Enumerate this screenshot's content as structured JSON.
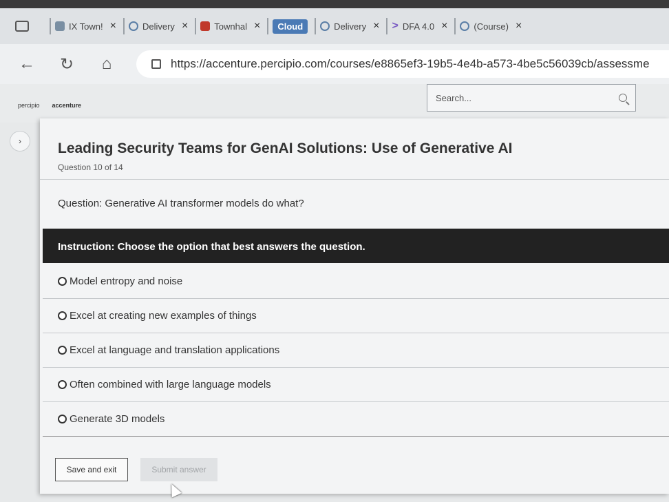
{
  "browser": {
    "tabs": [
      {
        "label": "IX Town!",
        "icon": "people-icon"
      },
      {
        "label": "Delivery",
        "icon": "w-logo-icon"
      },
      {
        "label": "Townhal",
        "icon": "red-icon"
      },
      {
        "label": "Cloud",
        "icon": "cloud-chip"
      },
      {
        "label": "Delivery",
        "icon": "w-logo-icon"
      },
      {
        "label": "DFA 4.0",
        "icon": "arrow-icon"
      },
      {
        "label": "(Course)",
        "icon": "w-logo-icon"
      }
    ],
    "url": "https://accenture.percipio.com/courses/e8865ef3-19b5-4e4b-a573-4be5c56039cb/assessme"
  },
  "header": {
    "logo_left": "percipio",
    "logo_right": "accenture",
    "search_placeholder": "Search..."
  },
  "quiz": {
    "title": "Leading Security Teams for GenAI Solutions: Use of Generative AI",
    "question_number": "Question 10 of 14",
    "question": "Question: Generative AI transformer models do what?",
    "instruction": "Instruction: Choose the option that best answers the question.",
    "options": [
      {
        "label": "Model entropy and noise"
      },
      {
        "label": "Excel at creating new examples of things"
      },
      {
        "label": "Excel at language and translation applications"
      },
      {
        "label": "Often combined with large language models"
      },
      {
        "label": "Generate 3D models"
      }
    ],
    "save_label": "Save and exit",
    "submit_label": "Submit answer"
  }
}
